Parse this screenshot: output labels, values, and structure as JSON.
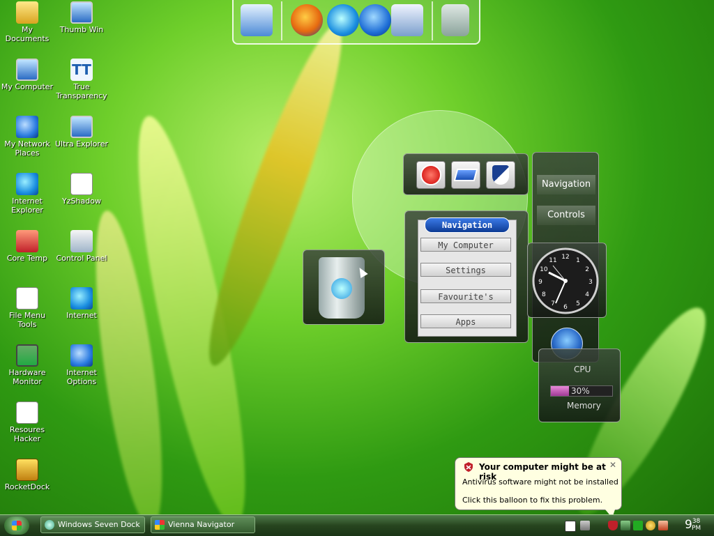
{
  "desktop_icons": [
    {
      "label": "My Documents",
      "icon": "folder-icon"
    },
    {
      "label": "Thumb Win",
      "icon": "thumbnail-icon"
    },
    {
      "label": "My Computer",
      "icon": "computer-icon"
    },
    {
      "label": "True Transparency",
      "icon": "tt-icon"
    },
    {
      "label": "My Network Places",
      "icon": "network-icon"
    },
    {
      "label": "Ultra Explorer",
      "icon": "explorer-icon"
    },
    {
      "label": "Internet Explorer",
      "icon": "ie-icon"
    },
    {
      "label": "YzShadow",
      "icon": "shadow-icon"
    },
    {
      "label": "Core Temp",
      "icon": "thermometer-icon"
    },
    {
      "label": "Control Panel",
      "icon": "control-panel-icon"
    },
    {
      "label": "File Menu Tools",
      "icon": "file-tools-icon"
    },
    {
      "label": "Internet",
      "icon": "ie-icon"
    },
    {
      "label": "Hardware Monitor",
      "icon": "chip-icon"
    },
    {
      "label": "Internet Options",
      "icon": "internet-options-icon"
    },
    {
      "label": "Resoures Hacker",
      "icon": "hacker-icon"
    },
    {
      "label": "RocketDock",
      "icon": "rocketdock-icon"
    }
  ],
  "top_dock": {
    "items": [
      "monitor-icon",
      "firefox-icon",
      "ie-icon",
      "media-player-icon",
      "control-panel-icon",
      "recycle-bin-icon"
    ]
  },
  "vienna_navigator": {
    "title": "Navigation",
    "buttons": [
      "My Computer",
      "Settings",
      "Favourite's",
      "Apps"
    ],
    "side_tabs": [
      "Navigation",
      "Controls"
    ]
  },
  "system_monitor": {
    "cpu_label": "CPU",
    "memory_percent_text": "30%",
    "memory_fill": 0.3,
    "memory_label": "Memory"
  },
  "balloon": {
    "title": "Your computer might be at risk",
    "line1": "Antivirus software might not be installed",
    "line2": "Click this balloon to fix this problem.",
    "close": "✕"
  },
  "taskbar": {
    "buttons": [
      "Windows Seven Dock",
      "Vienna Navigator"
    ],
    "time_hour": "9",
    "time_min": "38",
    "time_ampm": "PM"
  },
  "clock": {
    "numbers": [
      "12",
      "1",
      "2",
      "3",
      "4",
      "5",
      "6",
      "7",
      "8",
      "9",
      "10",
      "11"
    ]
  }
}
